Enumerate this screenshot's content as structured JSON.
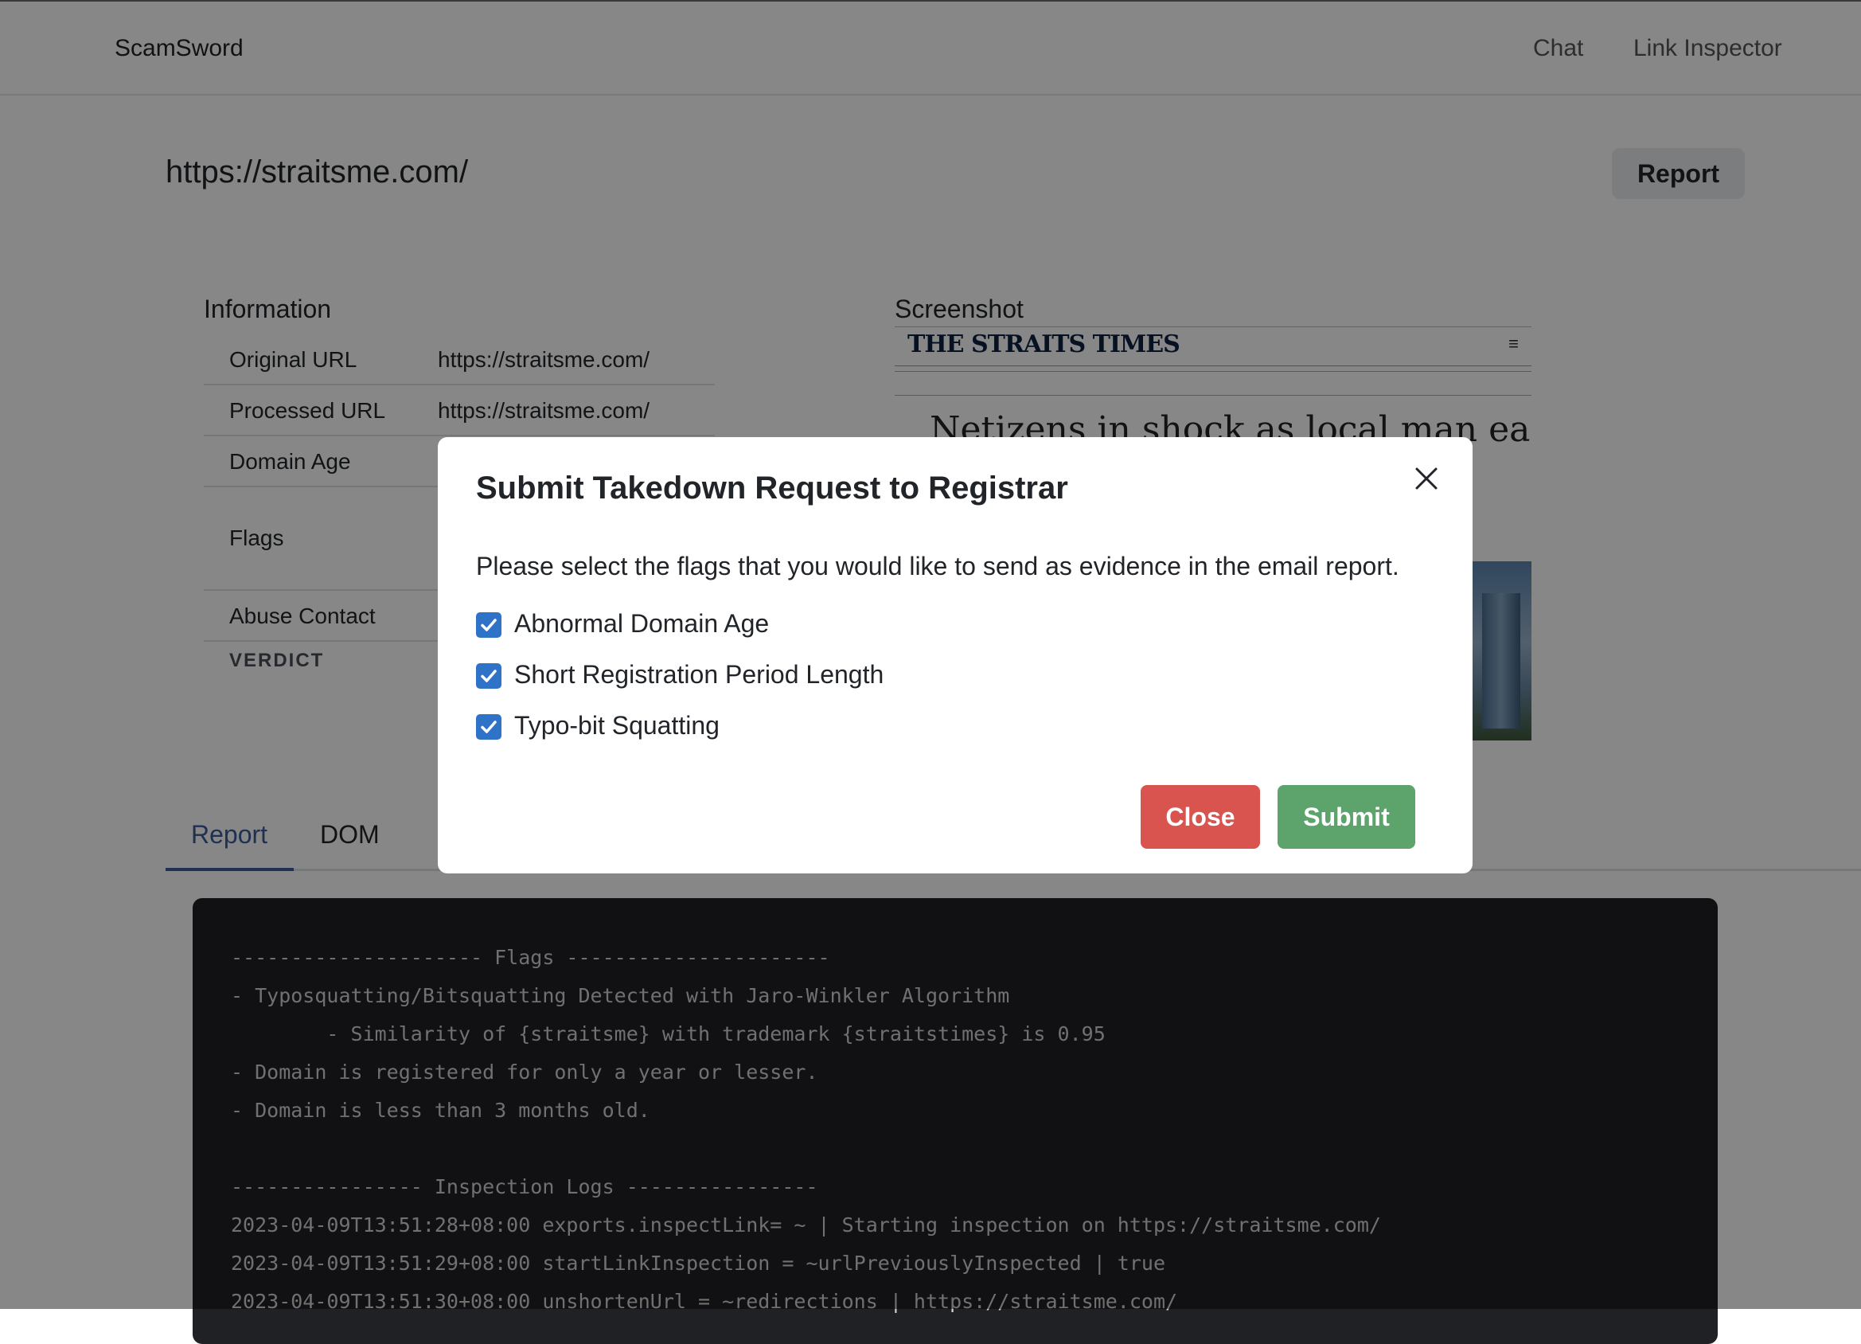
{
  "navbar": {
    "brand": "ScamSword",
    "links": [
      "Chat",
      "Link Inspector"
    ]
  },
  "page": {
    "url_title": "https://straitsme.com/",
    "report_button": "Report"
  },
  "information": {
    "heading": "Information",
    "rows": [
      {
        "key": "Original URL",
        "value": "https://straitsme.com/"
      },
      {
        "key": "Processed URL",
        "value": "https://straitsme.com/"
      },
      {
        "key": "Domain Age",
        "value": ""
      },
      {
        "key": "Flags",
        "value": ""
      },
      {
        "key": "Abuse Contact",
        "value": ""
      }
    ],
    "verdict_label": "VERDICT"
  },
  "screenshot": {
    "heading": "Screenshot",
    "site_logo": "THE STRAITS TIMES",
    "menu_glyph": "≡",
    "headline": "Netizens in shock as local man earned"
  },
  "tabs": {
    "report": "Report",
    "dom": "DOM"
  },
  "console": {
    "lines": [
      "--------------------- Flags ----------------------",
      "- Typosquatting/Bitsquatting Detected with Jaro-Winkler Algorithm",
      "        - Similarity of {straitsme} with trademark {straitstimes} is 0.95",
      "- Domain is registered for only a year or lesser.",
      "- Domain is less than 3 months old.",
      "",
      "---------------- Inspection Logs ----------------",
      "2023-04-09T13:51:28+08:00 exports.inspectLink= ~ | Starting inspection on https://straitsme.com/",
      "2023-04-09T13:51:29+08:00 startLinkInspection = ~urlPreviouslyInspected | true",
      "2023-04-09T13:51:30+08:00 unshortenUrl = ~redirections | https://straitsme.com/"
    ]
  },
  "modal": {
    "title": "Submit Takedown Request to Registrar",
    "description": "Please select the flags that you would like to send as evidence in the email report.",
    "flags": [
      {
        "label": "Abnormal Domain Age",
        "checked": true
      },
      {
        "label": "Short Registration Period Length",
        "checked": true
      },
      {
        "label": "Typo-bit Squatting",
        "checked": true
      }
    ],
    "close_button": "Close",
    "submit_button": "Submit",
    "colors": {
      "close": "#d9534f",
      "submit": "#5ca46c",
      "checkbox": "#2f73c9"
    }
  }
}
